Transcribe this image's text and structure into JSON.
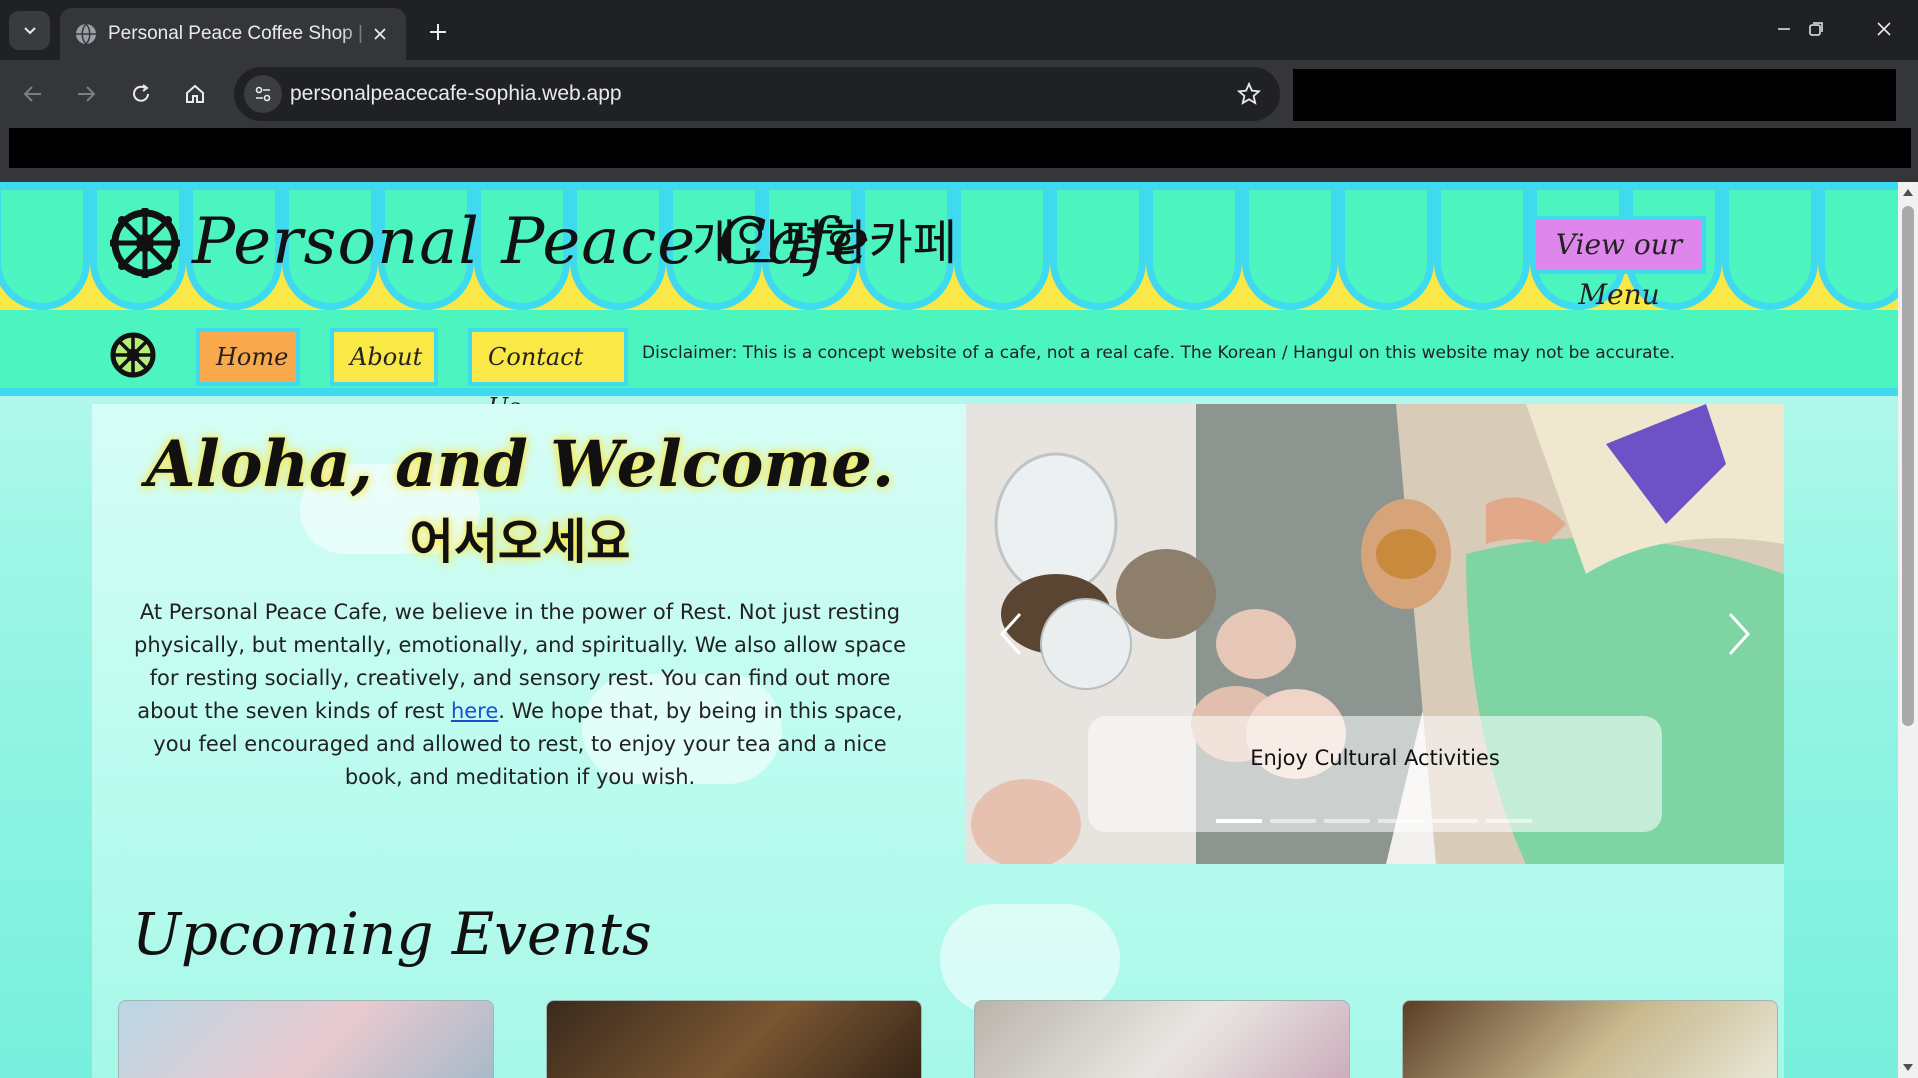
{
  "browser": {
    "tab_title": "Personal Peace Coffee Shop | Sc",
    "url": "personalpeacecafe-sophia.web.app"
  },
  "header": {
    "title": "Personal Peace Cafe",
    "title_korean": "개인평화카페",
    "menu_button": "View our Menu"
  },
  "nav": {
    "items": [
      {
        "label": "Home"
      },
      {
        "label": "About"
      },
      {
        "label": "Contact Us"
      }
    ],
    "disclaimer": "Disclaimer: This is a concept website of a cafe, not a real cafe. The Korean / Hangul on this website may not be accurate."
  },
  "welcome": {
    "title": "Aloha, and Welcome.",
    "title_korean": "어서오세요",
    "intro_before_link": "At Personal Peace Cafe, we believe in the power of Rest. Not just resting physically, but mentally, emotionally, and spiritually. We also allow space for resting socially, creatively, and sensory rest. You can find out more about the seven kinds of rest ",
    "intro_link": "here",
    "intro_after_link": ". We hope that, by being in this space, you feel encouraged and allowed to rest, to enjoy your tea and a nice book, and meditation if you wish."
  },
  "carousel": {
    "caption": "Enjoy Cultural Activities",
    "slide_count": 6,
    "active_index": 0
  },
  "events": {
    "title": "Upcoming Events"
  },
  "colors": {
    "awning_mint": "#4cf5c0",
    "awning_border": "#3fd9f0",
    "yellow": "#fae847",
    "orange": "#f9a94b",
    "menu_pink": "#df86ec"
  }
}
